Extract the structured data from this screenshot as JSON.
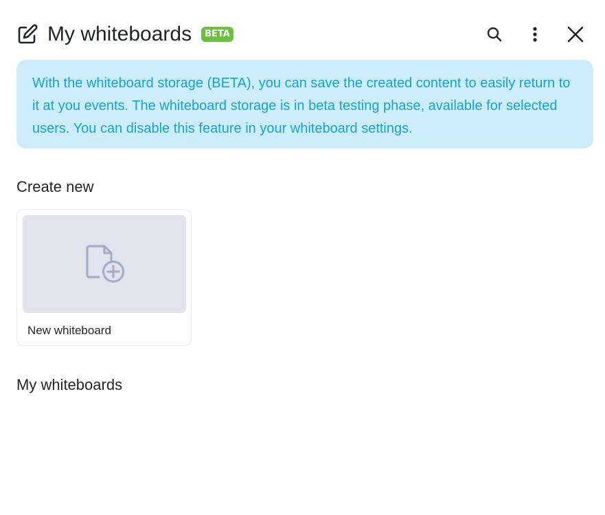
{
  "header": {
    "title": "My whiteboards",
    "badge": "BETA",
    "icons": {
      "edit": "edit-square-icon",
      "search": "search-icon",
      "more": "more-vertical-icon",
      "close": "close-icon"
    }
  },
  "info_banner": {
    "text": "With the whiteboard storage (BETA), you can save the created content to easily return to it at you events. The whiteboard storage is in beta testing phase, available for selected users. You can disable this feature in your whiteboard settings."
  },
  "create_section": {
    "heading": "Create new",
    "new_card": {
      "label": "New whiteboard",
      "icon": "file-add-icon"
    }
  },
  "my_section": {
    "heading": "My whiteboards"
  },
  "colors": {
    "badge_green": "#6bc13f",
    "banner_bg": "#ccedf9",
    "banner_text": "#12a4d6",
    "thumb_bg": "#e1e4ed",
    "thumb_icon": "#a7adc6",
    "text": "#1f2329"
  }
}
